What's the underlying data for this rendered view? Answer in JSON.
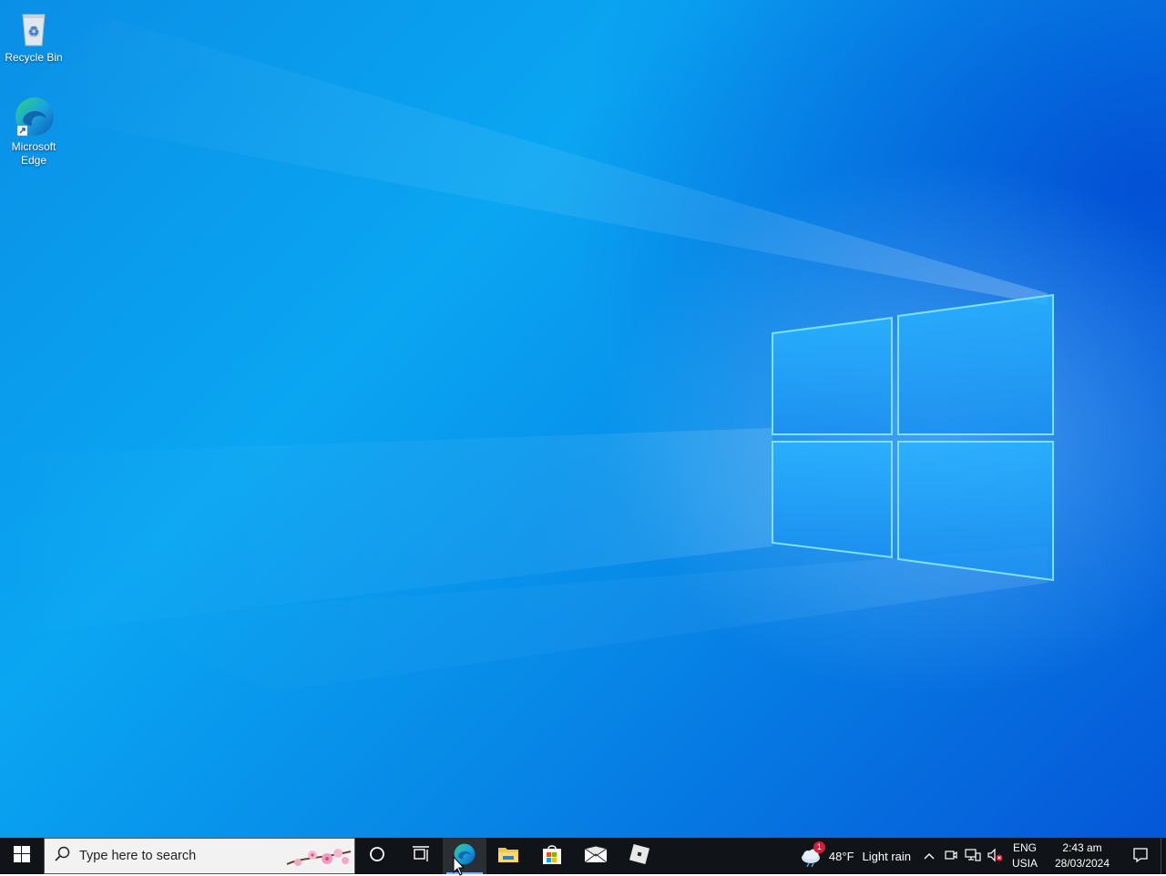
{
  "desktop": {
    "icons": [
      {
        "label": "Recycle Bin",
        "icon": "recycle-bin-icon"
      },
      {
        "label": "Microsoft Edge",
        "icon": "edge-icon"
      }
    ]
  },
  "taskbar": {
    "start_icon": "windows-logo-icon",
    "search": {
      "placeholder": "Type here to search",
      "icon": "search-icon"
    },
    "cortana_icon": "circle-icon",
    "task_view_icon": "task-view-icon",
    "pinned": [
      {
        "name": "Microsoft Edge",
        "icon": "edge-icon",
        "active": true
      },
      {
        "name": "File Explorer",
        "icon": "folder-icon"
      },
      {
        "name": "Microsoft Store",
        "icon": "store-icon"
      },
      {
        "name": "Mail",
        "icon": "mail-icon"
      },
      {
        "name": "Roblox",
        "icon": "roblox-icon"
      }
    ],
    "weather": {
      "temp": "48°F",
      "condition": "Light rain",
      "badge": "1"
    },
    "tray_icons": [
      "chevron-up-icon",
      "meet-now-icon",
      "network-icon",
      "volume-muted-icon"
    ],
    "language": {
      "line1": "ENG",
      "line2": "USIA"
    },
    "clock": {
      "time": "2:43 am",
      "date": "28/03/2024"
    },
    "notification_icon": "notification-icon"
  }
}
